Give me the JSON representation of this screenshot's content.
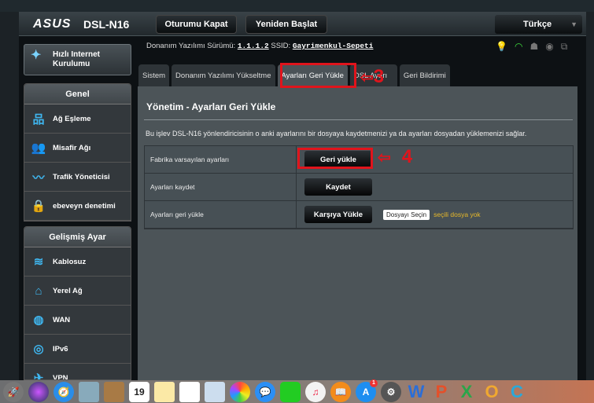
{
  "header": {
    "brand": "ASUS",
    "model": "DSL-N16",
    "logout": "Oturumu Kapat",
    "reboot": "Yeniden Başlat",
    "language": "Türkçe"
  },
  "info": {
    "fw_label": "Donanım Yazılımı Sürümü:",
    "fw_value": "1.1.1.2",
    "ssid_label": "SSID:",
    "ssid_value": "Gayrimenkul-Sepeti"
  },
  "sidebar": {
    "quick_setup": "Hızlı Internet Kurulumu",
    "general": {
      "title": "Genel",
      "items": [
        {
          "label": "Ağ Eşleme",
          "icon": "network-map-icon"
        },
        {
          "label": "Misafir Ağı",
          "icon": "guest-network-icon"
        },
        {
          "label": "Trafik Yöneticisi",
          "icon": "traffic-icon"
        },
        {
          "label": "ebeveyn denetimi",
          "icon": "lock-icon"
        }
      ]
    },
    "advanced": {
      "title": "Gelişmiş Ayar",
      "items": [
        {
          "label": "Kablosuz",
          "icon": "wifi-icon"
        },
        {
          "label": "Yerel Ağ",
          "icon": "home-icon"
        },
        {
          "label": "WAN",
          "icon": "globe-icon"
        },
        {
          "label": "IPv6",
          "icon": "ipv6-icon"
        },
        {
          "label": "VPN",
          "icon": "vpn-icon"
        }
      ]
    }
  },
  "tabs": [
    "Sistem",
    "Donanım Yazılımı Yükseltme",
    "Ayarları Geri Yükle",
    "DSL Ayarı",
    "Geri Bildirimi"
  ],
  "main": {
    "title": "Yönetim - Ayarları Geri Yükle",
    "description": "Bu işlev DSL-N16 yönlendiricisinin o anki ayarlarını bir dosyaya kaydetmenizi ya da ayarları dosyadan yüklemenizi sağlar.",
    "rows": [
      {
        "label": "Fabrika varsayılan ayarları",
        "button": "Geri yükle"
      },
      {
        "label": "Ayarları kaydet",
        "button": "Kaydet"
      },
      {
        "label": "Ayarları geri yükle",
        "button": "Karşıya Yükle",
        "file_button": "Dosyayı Seçin",
        "file_status": "seçili dosya yok"
      }
    ]
  },
  "annotations": {
    "step3": "3",
    "step4": "4"
  },
  "dock": {
    "calendar_day": "19",
    "appstore_badge": "1"
  },
  "colors": {
    "accent": "#3fb6ef",
    "annotation": "#e0141c",
    "file_status": "#e7b92a"
  }
}
